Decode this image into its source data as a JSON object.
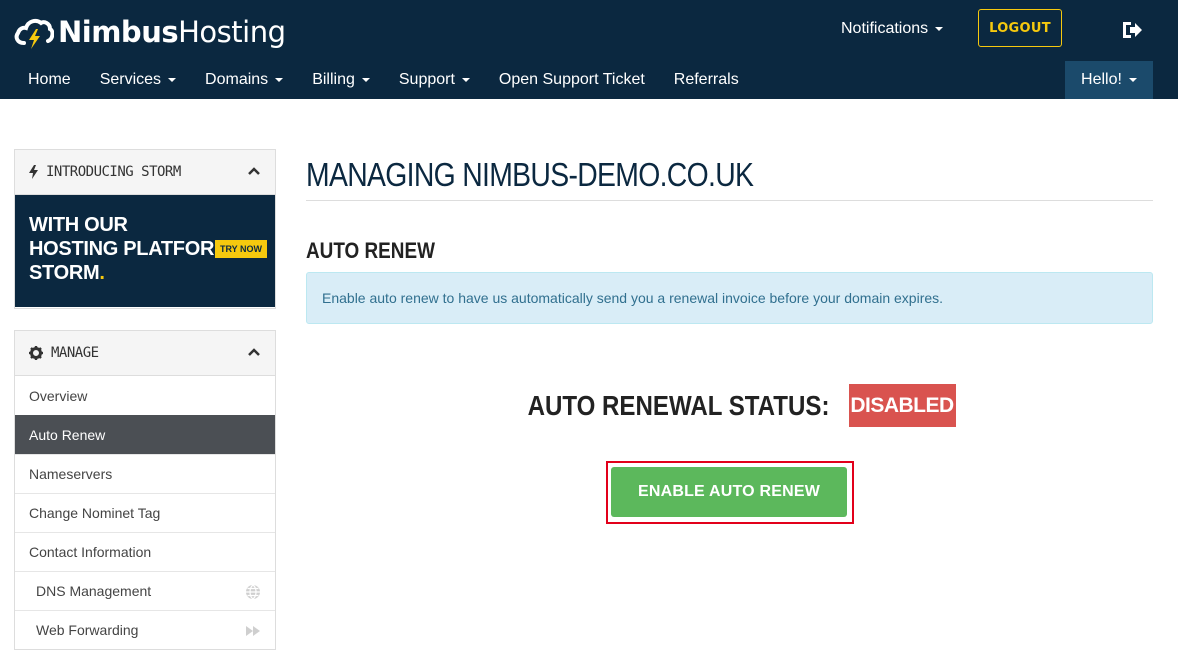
{
  "brand": {
    "name_bold": "Nimbus",
    "name_light": "Hosting",
    "accent": "#f6c90e",
    "navy": "#0b2840"
  },
  "header": {
    "notifications_label": "Notifications",
    "logout_label": "LOGOUT",
    "exit_icon": "sign-out-icon"
  },
  "nav": {
    "items": [
      {
        "label": "Home",
        "dropdown": false
      },
      {
        "label": "Services",
        "dropdown": true
      },
      {
        "label": "Domains",
        "dropdown": true
      },
      {
        "label": "Billing",
        "dropdown": true
      },
      {
        "label": "Support",
        "dropdown": true
      },
      {
        "label": "Open Support Ticket",
        "dropdown": false
      },
      {
        "label": "Referrals",
        "dropdown": false
      }
    ],
    "hello_label": "Hello!"
  },
  "sidebar": {
    "promo_panel": {
      "title": "INTRODUCING STORM",
      "icon": "bolt-icon",
      "line1": "WITH OUR",
      "line2": "HOSTING PLATFORM",
      "line3": "STORM",
      "line3_suffix": ".",
      "badge": "TRY NOW"
    },
    "manage_panel": {
      "title": "MANAGE",
      "icon": "gear-icon",
      "items": [
        {
          "label": "Overview",
          "active": false
        },
        {
          "label": "Auto Renew",
          "active": true
        },
        {
          "label": "Nameservers",
          "active": false
        },
        {
          "label": "Change Nominet Tag",
          "active": false
        },
        {
          "label": "Contact Information",
          "active": false
        },
        {
          "label": "DNS Management",
          "active": false,
          "icon": "globe-icon"
        },
        {
          "label": "Web Forwarding",
          "active": false,
          "icon": "fast-forward-icon"
        }
      ]
    }
  },
  "main": {
    "page_title": "MANAGING NIMBUS-DEMO.CO.UK",
    "section_title": "AUTO RENEW",
    "info_text": "Enable auto renew to have us automatically send you a renewal invoice before your domain expires.",
    "status_label": "AUTO RENEWAL STATUS:",
    "status_value": "DISABLED",
    "status_color": "#d9534f",
    "enable_button_label": "ENABLE AUTO RENEW",
    "button_color": "#5cb85c"
  }
}
